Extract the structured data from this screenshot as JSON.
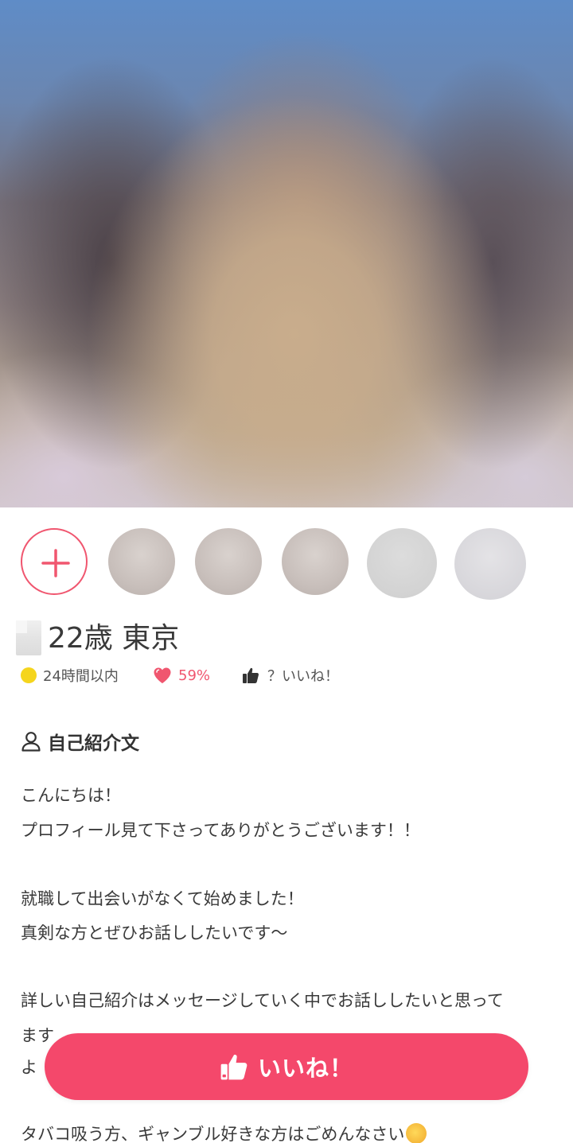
{
  "profile": {
    "name_age_location": "22歳 東京",
    "last_login": "24時間以内",
    "match_rate": "59%",
    "likes_count": "？いいね！"
  },
  "thumbnails": {
    "add_label": "+",
    "count": 5
  },
  "intro": {
    "section_title": "自己紹介文",
    "lines": [
      "こんにちは！",
      "プロフィール見て下さってありがとうございます！！",
      "",
      "就職して出会いがなくて始めました！",
      "真剣な方とぜひお話ししたいです〜",
      "",
      "詳しい自己紹介はメッセージしていく中でお話ししたいと思って",
      "ます",
      "よ",
      "",
      "タバコ吸う方、ギャンブル好きな方はごめんなさい"
    ]
  },
  "actions": {
    "like_button_label": "いいね！"
  },
  "colors": {
    "accent": "#f4486b",
    "online_dot": "#f5d51d",
    "text": "#3a3a3a"
  }
}
